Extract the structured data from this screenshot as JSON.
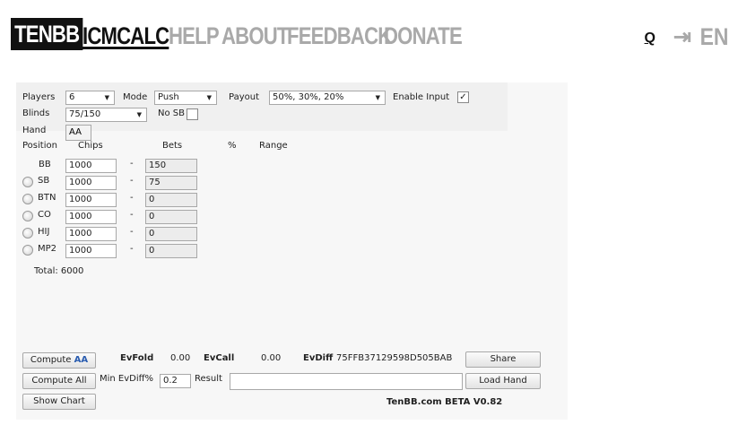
{
  "nav": {
    "logo": "TENBB",
    "items": [
      "ICMCALC",
      "HELP",
      "ABOUT",
      "FEEDBACK",
      "DONATE"
    ],
    "search": "Q",
    "lang": "EN"
  },
  "settings": {
    "players_label": "Players",
    "players_value": "6",
    "mode_label": "Mode",
    "mode_value": "Push",
    "payout_label": "Payout",
    "payout_value": "50%, 30%, 20%",
    "enable_input_label": "Enable Input",
    "enable_input_checked": "✓",
    "blinds_label": "Blinds",
    "blinds_value": "75/150",
    "no_sb_label": "No SB",
    "hand_label": "Hand",
    "hand_value": "AA"
  },
  "table": {
    "headers": {
      "position": "Position",
      "chips": "Chips",
      "bets": "Bets",
      "pct": "%",
      "range": "Range"
    },
    "rows": [
      {
        "pos": "BB",
        "chips": "1000",
        "dash": "-",
        "bet": "150"
      },
      {
        "pos": "SB",
        "chips": "1000",
        "dash": "-",
        "bet": "75"
      },
      {
        "pos": "BTN",
        "chips": "1000",
        "dash": "-",
        "bet": "0"
      },
      {
        "pos": "CO",
        "chips": "1000",
        "dash": "-",
        "bet": "0"
      },
      {
        "pos": "HIJ",
        "chips": "1000",
        "dash": "-",
        "bet": "0"
      },
      {
        "pos": "MP2",
        "chips": "1000",
        "dash": "-",
        "bet": "0"
      }
    ],
    "total": "Total: 6000"
  },
  "results": {
    "compute_label": "Compute",
    "compute_hand": "AA",
    "evfold_label": "EvFold",
    "evfold_value": "0.00",
    "evcall_label": "EvCall",
    "evcall_value": "0.00",
    "evdiff_label": "EvDiff",
    "evdiff_value": "75FFB37129598D505BAB",
    "share_label": "Share",
    "compute_all_label": "Compute All",
    "min_evdiff_label": "Min EvDiff%",
    "min_evdiff_value": "0.2",
    "result_label": "Result",
    "result_value": "",
    "load_hand_label": "Load Hand",
    "show_chart_label": "Show Chart",
    "version": "TenBB.com BETA V0.82"
  }
}
